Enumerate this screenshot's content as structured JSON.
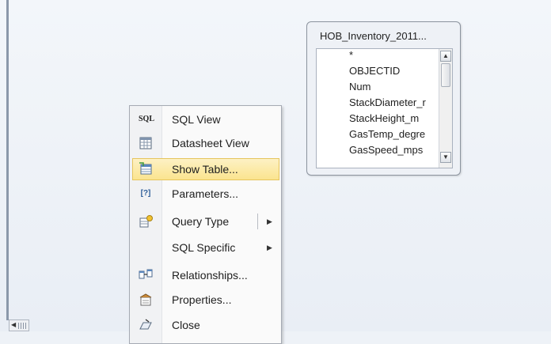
{
  "table_box": {
    "title": "HOB_Inventory_2011...",
    "fields": [
      "*",
      "OBJECTID",
      "Num",
      "StackDiameter_r",
      "StackHeight_m",
      "GasTemp_degre",
      "GasSpeed_mps"
    ]
  },
  "context_menu": {
    "items": [
      {
        "label": "SQL View",
        "icon": "sql-icon",
        "icon_text": "SQL"
      },
      {
        "label": "Datasheet View",
        "icon": "datasheet-icon"
      },
      {
        "label": "Show Table...",
        "icon": "show-table-icon",
        "highlighted": true
      },
      {
        "label": "Parameters...",
        "icon": "parameters-icon",
        "icon_text": "[?]"
      },
      {
        "label": "Query Type",
        "icon": "query-type-icon",
        "has_submenu": true
      },
      {
        "label": "SQL Specific",
        "icon": "",
        "has_submenu": true
      },
      {
        "label": "Relationships...",
        "icon": "relationships-icon"
      },
      {
        "label": "Properties...",
        "icon": "properties-icon"
      },
      {
        "label": "Close",
        "icon": "close-icon"
      }
    ]
  },
  "colors": {
    "highlight": "#fbe48f",
    "highlight_border": "#e6c55d",
    "background": "#eef2f7"
  }
}
